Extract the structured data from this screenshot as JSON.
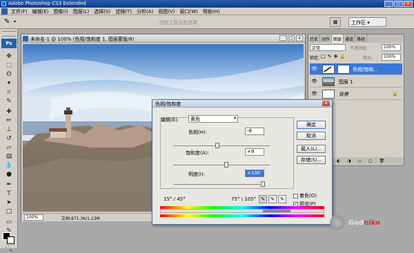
{
  "window": {
    "title": "Adobe Photoshop CS3 Extended",
    "min_label": "_",
    "max_label": "□",
    "close_label": "X"
  },
  "menu": [
    "文件(F)",
    "编辑(E)",
    "图像(I)",
    "图层(L)",
    "选择(S)",
    "滤镜(T)",
    "分析(A)",
    "视图(V)",
    "窗口(W)",
    "帮助(H)"
  ],
  "options_bar": {
    "hint": "当前工具没有选项",
    "workspace_label": "工作区 ▾"
  },
  "toolbox": {
    "logo": "Ps",
    "tools": [
      "move-tool-icon",
      "marquee-tool-icon",
      "lasso-tool-icon",
      "magic-wand-tool-icon",
      "crop-tool-icon",
      "eyedropper-tool-icon",
      "heal-tool-icon",
      "brush-tool-icon",
      "stamp-tool-icon",
      "history-brush-tool-icon",
      "eraser-tool-icon",
      "gradient-tool-icon",
      "blur-tool-icon",
      "dodge-tool-icon",
      "pen-tool-icon",
      "type-tool-icon",
      "path-select-tool-icon",
      "shape-tool-icon",
      "notes-tool-icon",
      "eyedropper2-tool-icon",
      "hand-tool-icon",
      "zoom-tool-icon"
    ]
  },
  "document": {
    "title": "未命名-1 @ 100% (色相/饱和度 1, 图层蒙版/8)",
    "zoom": "100%",
    "doc_size": "文档:871.3K/1.13M"
  },
  "layers_panel": {
    "tabs": [
      "历史",
      "动作",
      "图层",
      "通道",
      "路径"
    ],
    "active_tab": "图层",
    "blend_mode": "正常",
    "opacity_label": "不透明度:",
    "opacity_value": "100%",
    "lock_label": "锁定:",
    "fill_label": "填充:",
    "fill_value": "100%",
    "layers": [
      {
        "name": "色相/饱和...",
        "selected": true
      },
      {
        "name": "图层 1",
        "selected": false
      },
      {
        "name": "背景",
        "selected": false
      }
    ],
    "footer_icons": "⛓ fx ◐ ◑ ▭ ▢ 🗑"
  },
  "dialog": {
    "title": "色相/饱和度",
    "edit_label": "编辑(E):",
    "edit_value": "黄色",
    "hue_label": "色相(H):",
    "hue_value": "-8",
    "hue_position": 0.46,
    "saturation_label": "饱和度(A):",
    "saturation_value": "+9",
    "saturation_position": 0.55,
    "lightness_label": "明度(I):",
    "lightness_value": "+100",
    "lightness_position": 1.0,
    "ok": "确定",
    "cancel": "取消",
    "load": "载入(L)...",
    "save": "存储(S)...",
    "range_left": "15° / 45°",
    "range_right": "75° \\ 105°",
    "colorize_label": "着色(O)",
    "colorize_checked": false,
    "preview_label": "预览(P)",
    "preview_checked": true
  },
  "watermark": {
    "text_a": "God",
    "text_b": "niko"
  }
}
